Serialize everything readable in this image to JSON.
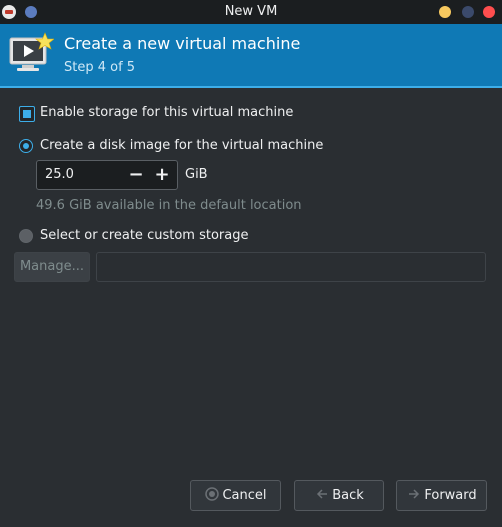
{
  "window": {
    "title": "New VM",
    "app_icon": "virt-manager-icon",
    "controls": {
      "minimize": "minimize-icon",
      "maximize": "maximize-icon",
      "close": "close-icon"
    },
    "colors": {
      "minimize": "#f6c85f",
      "close": "#ff4e4e"
    }
  },
  "header": {
    "title": "Create a new virtual machine",
    "step": "Step 4 of 5",
    "icon": "new-vm-icon",
    "background": "#0f79b5"
  },
  "storage": {
    "enable_label": "Enable storage for this virtual machine",
    "enable_checked": true,
    "disk_image_label": "Create a disk image for the virtual machine",
    "disk_image_selected": true,
    "size_value": "25.0",
    "size_unit": "GiB",
    "decrement_symbol": "−",
    "increment_symbol": "+",
    "available_hint": "49.6 GiB available in the default location",
    "custom_label": "Select or create custom storage",
    "custom_selected": false,
    "manage_label": "Manage...",
    "custom_path_value": ""
  },
  "footer": {
    "cancel_label": "Cancel",
    "back_label": "Back",
    "forward_label": "Forward",
    "cancel_icon": "cancel-icon",
    "back_icon": "arrow-left-icon",
    "forward_icon": "arrow-right-icon"
  },
  "accent_color": "#3daee9"
}
